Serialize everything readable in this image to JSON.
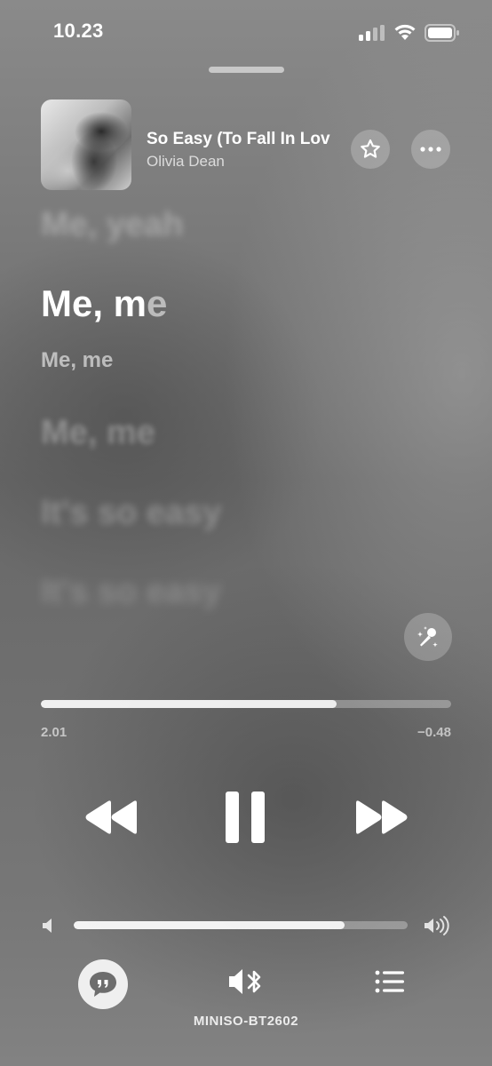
{
  "status_bar": {
    "time": "10.23",
    "icons": [
      "signal-icon",
      "wifi-icon",
      "battery-icon"
    ]
  },
  "now_playing": {
    "title": "So Easy (To Fall In Lov",
    "artist": "Olivia Dean",
    "album_art": "album-art",
    "favorite_icon": "star-icon",
    "more_icon": "ellipsis-icon"
  },
  "lyrics": {
    "previous": "Me, yeah",
    "current_sung": "Me, m",
    "current_unsung": "e",
    "next": "Me, me",
    "upcoming": [
      "Me, me",
      "It's so easy",
      "It's so easy"
    ],
    "sing_icon": "microphone-sparkle-icon"
  },
  "progress": {
    "elapsed": "2.01",
    "remaining": "−0.48",
    "fraction": 0.72
  },
  "transport": {
    "rewind_icon": "rewind-icon",
    "play_pause_icon": "pause-icon",
    "forward_icon": "fast-forward-icon"
  },
  "volume": {
    "level": 0.81,
    "low_icon": "speaker-low-icon",
    "high_icon": "speaker-high-icon"
  },
  "bottom_bar": {
    "lyrics_icon": "lyrics-quote-icon",
    "airplay_icon": "speaker-bluetooth-icon",
    "queue_icon": "queue-list-icon",
    "output_device": "MINISO-BT2602"
  },
  "colors": {
    "background": "#777777",
    "foreground": "#ffffff"
  }
}
